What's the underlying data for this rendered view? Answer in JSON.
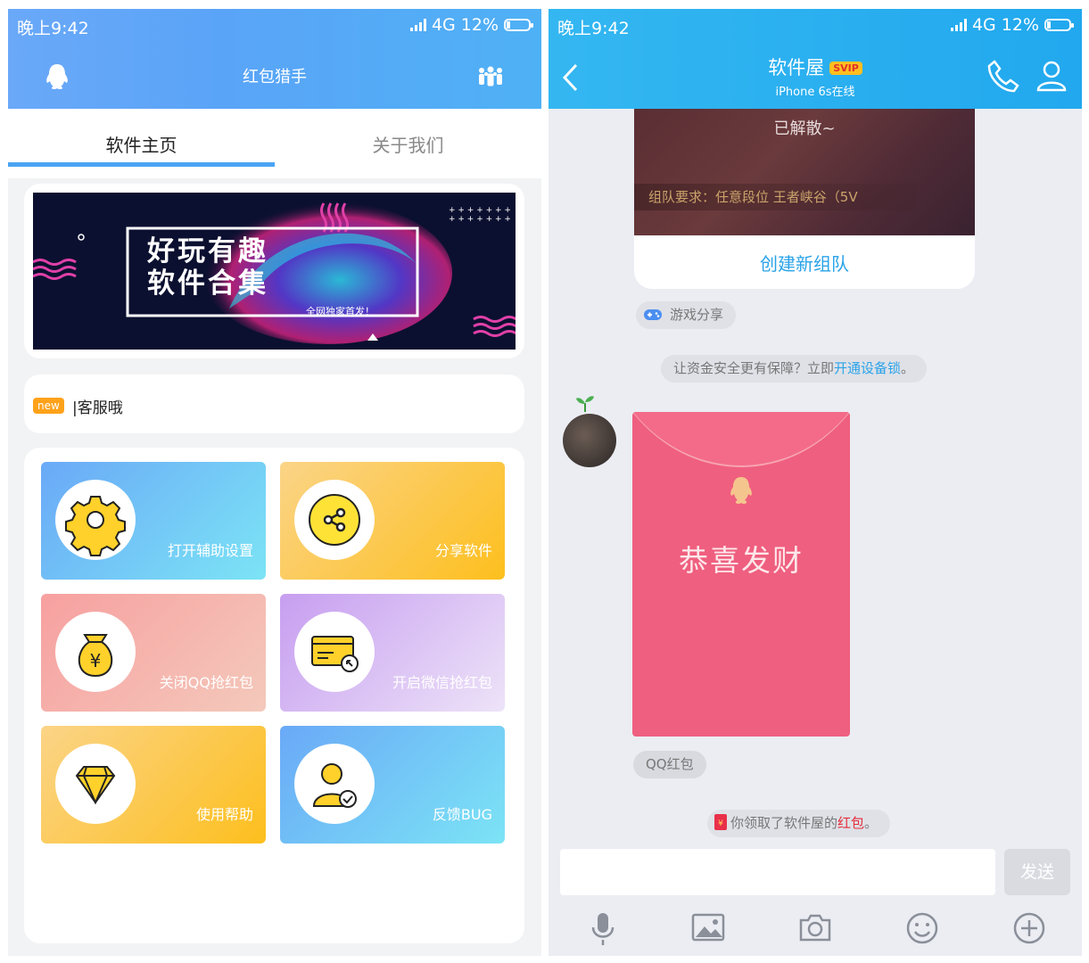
{
  "status_bar": {
    "time": "晚上9:42",
    "network": "4G",
    "battery": "12%"
  },
  "left": {
    "app_title": "红包猎手",
    "tabs": [
      {
        "label": "软件主页"
      },
      {
        "label": "关于我们"
      }
    ],
    "banner": {
      "title_line1": "好玩有趣",
      "title_line2": "软件合集",
      "subtitle": "全网独家首发！"
    },
    "notice": {
      "badge": "new",
      "text": "|客服哦"
    },
    "tiles": [
      {
        "label": "打开辅助设置",
        "icon": "gear-icon"
      },
      {
        "label": "分享软件",
        "icon": "share-icon"
      },
      {
        "label": "关闭QQ抢红包",
        "icon": "money-bag-icon"
      },
      {
        "label": "开启微信抢红包",
        "icon": "card-icon"
      },
      {
        "label": "使用帮助",
        "icon": "diamond-icon"
      },
      {
        "label": "反馈BUG",
        "icon": "user-check-icon"
      }
    ]
  },
  "right": {
    "chat_name": "软件屋",
    "svip": "SVIP",
    "chat_status": "iPhone 6s在线",
    "team_card": {
      "dissolved": "已解散~",
      "requirement": "组队要求：任意段位 王者峡谷（5V",
      "create": "创建新组队"
    },
    "game_share": "游戏分享",
    "security_tip": {
      "text": "让资金安全更有保障？立即",
      "link": "开通设备锁",
      "end": "。"
    },
    "red_packet": {
      "greeting": "恭喜发财",
      "label": "QQ红包"
    },
    "received": {
      "prefix": "你领取了软件屋的",
      "highlight": "红包",
      "end": "。"
    },
    "send_button": "发送"
  }
}
